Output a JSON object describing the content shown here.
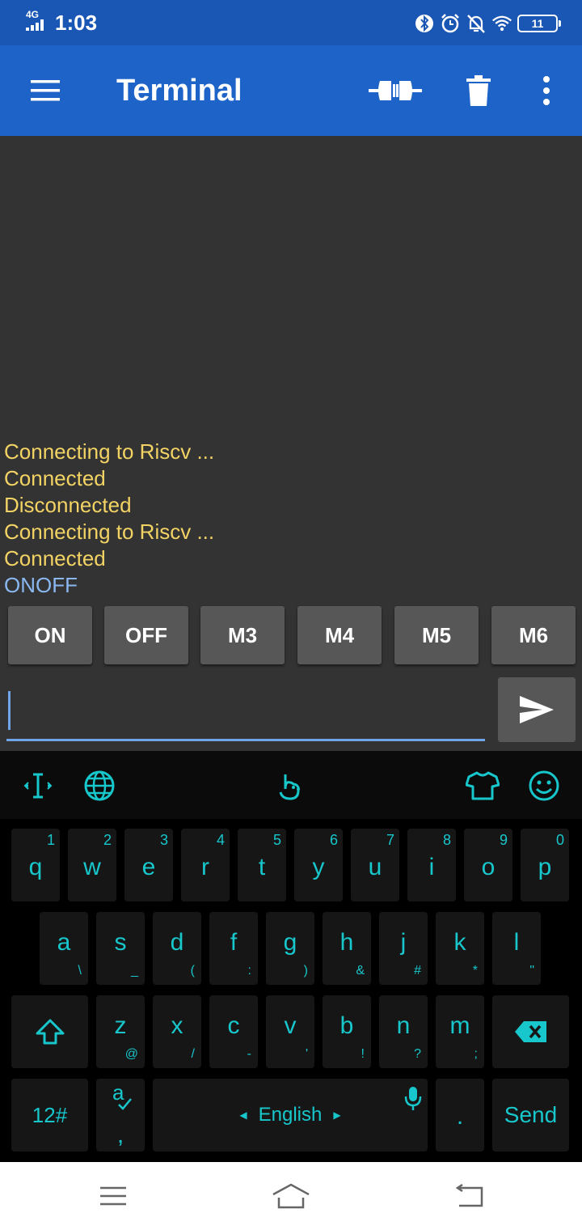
{
  "status_bar": {
    "network": "4G",
    "time": "1:03",
    "battery": "11",
    "icons": [
      "bluetooth-icon",
      "alarm-icon",
      "notifications-off-icon",
      "wifi-icon",
      "battery-icon"
    ]
  },
  "toolbar": {
    "title": "Terminal",
    "actions": [
      "connect-icon",
      "delete-icon",
      "more-vert-icon"
    ]
  },
  "terminal": {
    "lines": [
      {
        "text": "Connecting to Riscv ...",
        "kind": "status"
      },
      {
        "text": "Connected",
        "kind": "status"
      },
      {
        "text": "Disconnected",
        "kind": "status"
      },
      {
        "text": "Connecting to Riscv ...",
        "kind": "status"
      },
      {
        "text": "Connected",
        "kind": "status"
      },
      {
        "text": "ONOFF",
        "kind": "sent"
      }
    ],
    "colors": {
      "status": "#f2d364",
      "sent": "#8ab8f0",
      "background": "#333333"
    }
  },
  "macros": [
    "ON",
    "OFF",
    "M3",
    "M4",
    "M5",
    "M6"
  ],
  "input": {
    "value": "",
    "placeholder": ""
  },
  "keyboard": {
    "toolbar_icons": [
      "cursor-icon",
      "globe-icon",
      "gesture-icon",
      "theme-shirt-icon",
      "emoji-icon"
    ],
    "row1": [
      {
        "k": "q",
        "s": "1"
      },
      {
        "k": "w",
        "s": "2"
      },
      {
        "k": "e",
        "s": "3"
      },
      {
        "k": "r",
        "s": "4"
      },
      {
        "k": "t",
        "s": "5"
      },
      {
        "k": "y",
        "s": "6"
      },
      {
        "k": "u",
        "s": "7"
      },
      {
        "k": "i",
        "s": "8"
      },
      {
        "k": "o",
        "s": "9"
      },
      {
        "k": "p",
        "s": "0"
      }
    ],
    "row2": [
      {
        "k": "a",
        "s": "\\"
      },
      {
        "k": "s",
        "s": "_"
      },
      {
        "k": "d",
        "s": "("
      },
      {
        "k": "f",
        "s": ":"
      },
      {
        "k": "g",
        "s": ")"
      },
      {
        "k": "h",
        "s": "&"
      },
      {
        "k": "j",
        "s": "#"
      },
      {
        "k": "k",
        "s": "*"
      },
      {
        "k": "l",
        "s": "\""
      }
    ],
    "row3": [
      {
        "k": "z",
        "s": "@"
      },
      {
        "k": "x",
        "s": "/"
      },
      {
        "k": "c",
        "s": "-"
      },
      {
        "k": "v",
        "s": "'"
      },
      {
        "k": "b",
        "s": "!"
      },
      {
        "k": "n",
        "s": "?"
      },
      {
        "k": "m",
        "s": ";"
      }
    ],
    "symbols_key": "12#",
    "comma_key": ",",
    "space_label": "English",
    "period_key": ".",
    "enter_label": "Send",
    "accent_color": "#17c7cc"
  },
  "nav_bar": {
    "icons": [
      "menu-icon",
      "home-icon",
      "back-icon"
    ]
  }
}
